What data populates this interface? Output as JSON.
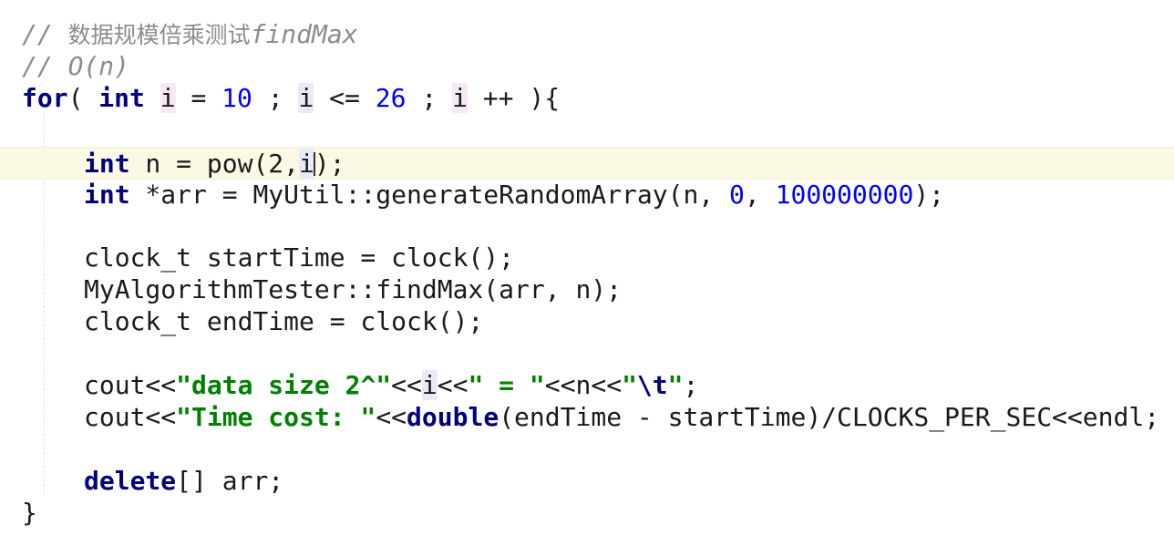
{
  "editor": {
    "lines": {
      "comment1": {
        "slashes": "// ",
        "cjk": "数据规模倍乘测试",
        "fn": "findMax"
      },
      "comment2": {
        "text": "// O(n)"
      },
      "for_line": {
        "kw_for": "for",
        "p1": "( ",
        "kw_int": "int",
        "sp1": " ",
        "var_i1": "i",
        "p2": " = ",
        "num_start": "10",
        "p3": " ; ",
        "var_i2": "i",
        "p4": " <= ",
        "num_end": "26",
        "p5": " ; ",
        "var_i3": "i",
        "p6": " ++ ){"
      },
      "pow_line": {
        "kw_int": "int",
        "p1": " n = pow(",
        "num_base": "2",
        "p2": ",",
        "var_i": "i",
        "p3": ");"
      },
      "arr_line": {
        "kw_int": "int",
        "p1": " *arr = MyUtil::generateRandomArray(n, ",
        "num_zero": "0",
        "p2": ", ",
        "num_max": "100000000",
        "p3": ");"
      },
      "start_line": {
        "text": "clock_t startTime = clock();"
      },
      "find_line": {
        "text": "MyAlgorithmTester::findMax(arr, n);"
      },
      "end_line": {
        "text": "clock_t endTime = clock();"
      },
      "cout1_line": {
        "p1": "cout<<",
        "str1": "\"data size 2^\"",
        "p2": "<<",
        "var_i": "i",
        "p3": "<<",
        "str2": "\" = \"",
        "p4": "<<n<<",
        "str3_open": "\"",
        "esc": "\\t",
        "str3_close": "\"",
        "p5": ";"
      },
      "cout2_line": {
        "p1": "cout<<",
        "str1": "\"Time cost: \"",
        "p2": "<<",
        "kw_double": "double",
        "p3": "(endTime - startTime)/CLOCKS_PER_SEC<<endl;"
      },
      "delete_line": {
        "kw_delete": "delete",
        "p1": "[] arr;"
      },
      "close_line": {
        "text": "}"
      }
    }
  }
}
